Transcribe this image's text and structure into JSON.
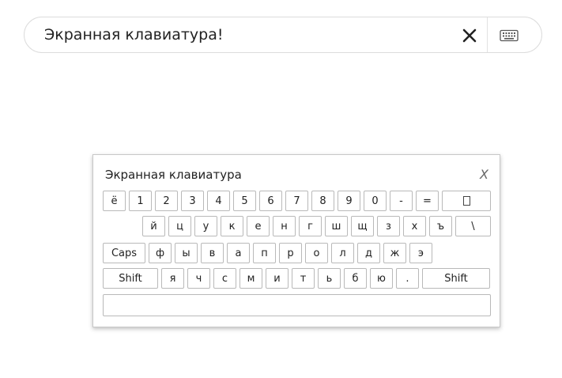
{
  "search": {
    "value": "Экранная клавиатура!",
    "clear_icon": "close-icon",
    "keyboard_icon": "keyboard-icon"
  },
  "keyboard": {
    "title": "Экранная клавиатура",
    "close_label": "X",
    "rows": [
      [
        "ё",
        "1",
        "2",
        "3",
        "4",
        "5",
        "6",
        "7",
        "8",
        "9",
        "0",
        "-",
        "=",
        ""
      ],
      [
        "й",
        "ц",
        "у",
        "к",
        "е",
        "н",
        "г",
        "ш",
        "щ",
        "з",
        "х",
        "ъ",
        "\\"
      ],
      [
        "Caps",
        "ф",
        "ы",
        "в",
        "а",
        "п",
        "р",
        "о",
        "л",
        "д",
        "ж",
        "э"
      ],
      [
        "Shift",
        "я",
        "ч",
        "с",
        "м",
        "и",
        "т",
        "ь",
        "б",
        "ю",
        ".",
        "Shift"
      ],
      [
        ""
      ]
    ]
  }
}
